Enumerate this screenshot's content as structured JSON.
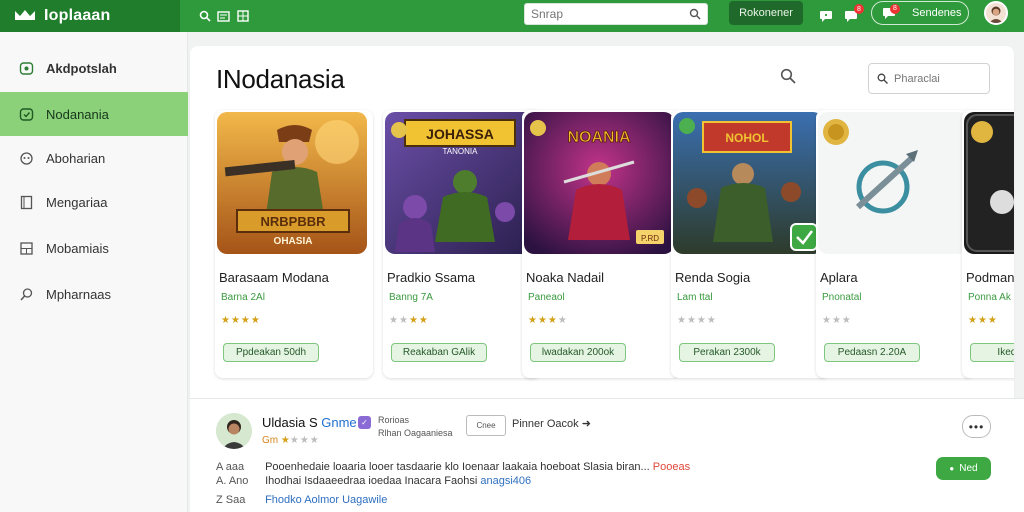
{
  "topbar": {
    "brand": "Ioplaaan",
    "search_placeholder": "Snrap",
    "dark_button": "Rokonener",
    "notif_badge": "8",
    "pill_badge": "8",
    "pill_label": "Sendenes",
    "accent": "#2f9a3c"
  },
  "sidebar": {
    "items": [
      {
        "label": "Akdpotslah",
        "icon": "gamepad-icon"
      },
      {
        "label": "Nodanania",
        "icon": "chat-icon"
      },
      {
        "label": "Aboharian",
        "icon": "headset-icon"
      },
      {
        "label": "Mengariaa",
        "icon": "book-icon"
      },
      {
        "label": "Mobamiais",
        "icon": "grid-icon"
      },
      {
        "label": "Mpharnaas",
        "icon": "search-icon"
      }
    ],
    "active_index": 1,
    "active_color": "#8bd17a"
  },
  "main": {
    "title": "INodanasia",
    "search_placeholder": "Pharaclai",
    "cards": [
      {
        "title": "Barasaam Modana",
        "sub": "Barna 2Al",
        "stars": "★★★★",
        "rating": 4,
        "button": "Ppdeakan 50dh",
        "art_text_1": "NRBPBBR",
        "art_text_2": "OHASIA"
      },
      {
        "title": "Pradkio Ssama",
        "sub": "Banng 7A",
        "stars": "★★★★",
        "rating": 2,
        "button": "Reakaban GAlik",
        "art_text_1": "JOHASSA",
        "art_text_2": "TANONIA"
      },
      {
        "title": "Noaka Nadail",
        "sub": "Paneaol",
        "stars": "★★★★",
        "rating": 3,
        "button": "lwadakan 200ok",
        "art_text_1": "NOANIA",
        "art_text_2": "",
        "art_tag": "P.RD"
      },
      {
        "title": "Renda Sogia",
        "sub": "Lam ttal",
        "stars": "★★★★",
        "rating": 0,
        "button": "Perakan 2300k",
        "art_text_1": "NOHOL",
        "art_text_2": ""
      },
      {
        "title": "Aplara",
        "sub": "Pnonatal",
        "stars": "★★★",
        "rating": 0,
        "button": "Pedaasn 2.20A",
        "art_text_1": "",
        "art_text_2": ""
      },
      {
        "title": "Podman",
        "sub": "Ponna Ak",
        "stars": "★★★",
        "rating": 3,
        "button": "Ikedahan",
        "art_text_1": "",
        "art_text_2": ""
      }
    ]
  },
  "review": {
    "name": "Uldasia S",
    "name_accent": "Gnme",
    "verified": "✓",
    "sub_line_1": "Rorioas",
    "sub_line_2": "Rlhan Oagaaniesa",
    "meta_prefix": "Gm",
    "meta_stars": "★★★★",
    "meta_rating": 1,
    "outline_button": "Cnee",
    "link": "Pinner Oacok ➜",
    "more": "•••",
    "green_button": "Ned",
    "green_icon": "●",
    "lines": [
      {
        "pre": "A  aaa",
        "text": "Pooenhedaie loaaria looer tasdaarie klo Ioenaar laakaia hoeboat Slasia biran...",
        "tail": "Pooeas"
      },
      {
        "pre": "A. Ano",
        "text": "Ihodhai Isdaaeedraa ioedaa Inacara Faohsi",
        "tail_blue": "anagsi406"
      },
      {
        "pre": "Z  Saa",
        "text": "",
        "tail_blue": "Fhodko Aolmor Uagawile"
      }
    ]
  }
}
